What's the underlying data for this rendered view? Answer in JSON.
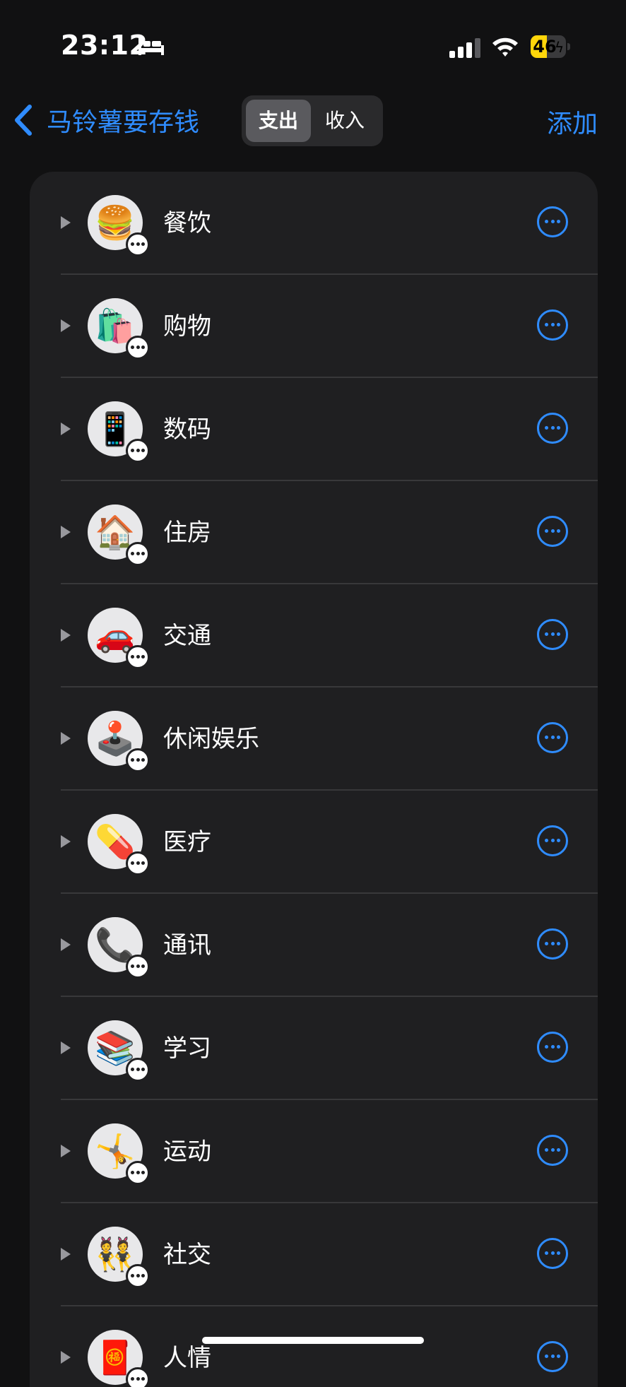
{
  "status_bar": {
    "time": "23:12",
    "battery": "46",
    "battery_level": 0.46
  },
  "nav": {
    "back_label": "马铃薯要存钱",
    "add_label": "添加"
  },
  "segment": {
    "options": [
      "支出",
      "收入"
    ],
    "selected": "支出"
  },
  "categories": [
    {
      "icon": "hamburger-icon",
      "emoji": "🍔",
      "label": "餐饮"
    },
    {
      "icon": "shopping-bags-icon",
      "emoji": "🛍️",
      "label": "购物"
    },
    {
      "icon": "mobile-phone-icon",
      "emoji": "📱",
      "label": "数码"
    },
    {
      "icon": "house-icon",
      "emoji": "🏠",
      "label": "住房"
    },
    {
      "icon": "car-icon",
      "emoji": "🚗",
      "label": "交通"
    },
    {
      "icon": "joystick-icon",
      "emoji": "🕹️",
      "label": "休闲娱乐"
    },
    {
      "icon": "pill-icon",
      "emoji": "💊",
      "label": "医疗"
    },
    {
      "icon": "telephone-icon",
      "emoji": "📞",
      "label": "通讯"
    },
    {
      "icon": "books-icon",
      "emoji": "📚",
      "label": "学习"
    },
    {
      "icon": "cartwheel-icon",
      "emoji": "🤸",
      "label": "运动"
    },
    {
      "icon": "dancers-icon",
      "emoji": "👯",
      "label": "社交"
    },
    {
      "icon": "red-envelope-icon",
      "emoji": "🧧",
      "label": "人情"
    }
  ]
}
